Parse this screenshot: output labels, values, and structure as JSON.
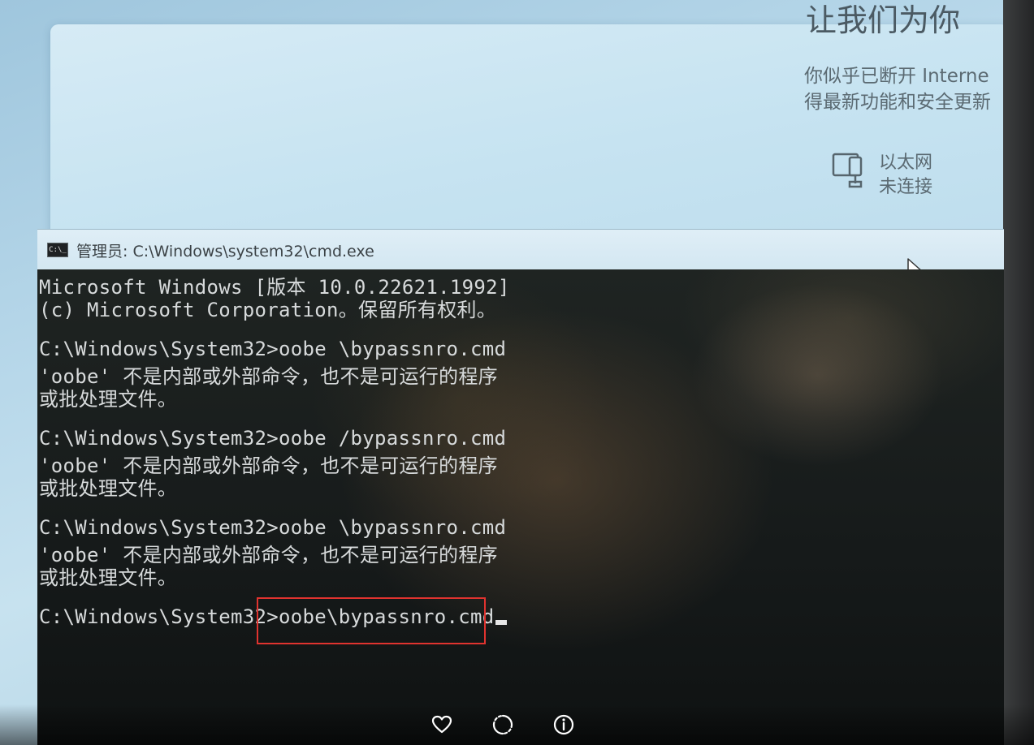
{
  "oobe": {
    "title_partial": "让我们为你",
    "desc_line1": "你似乎已断开 Interne",
    "desc_line2": "得最新功能和安全更新",
    "ethernet_label": "以太网",
    "ethernet_status": "未连接"
  },
  "cmd": {
    "window_title": "管理员: C:\\Windows\\system32\\cmd.exe",
    "icon_text": "C:\\_",
    "lines": [
      "Microsoft Windows [版本 10.0.22621.1992]",
      "(c) Microsoft Corporation。保留所有权利。",
      "C:\\Windows\\System32>oobe \\bypassnro.cmd",
      "'oobe' 不是内部或外部命令，也不是可运行的程序",
      "或批处理文件。",
      "C:\\Windows\\System32>oobe /bypassnro.cmd",
      "'oobe' 不是内部或外部命令，也不是可运行的程序",
      "或批处理文件。",
      "C:\\Windows\\System32>oobe \\bypassnro.cmd",
      "'oobe' 不是内部或外部命令，也不是可运行的程序",
      "或批处理文件。"
    ],
    "prompt": "C:\\Windows\\System32>",
    "current_input": "oobe\\bypassnro.cmd",
    "highlight_color": "#e0332f"
  },
  "viewer_toolbar": {
    "icons": [
      "heart-icon",
      "rotate-icon",
      "info-icon"
    ]
  }
}
